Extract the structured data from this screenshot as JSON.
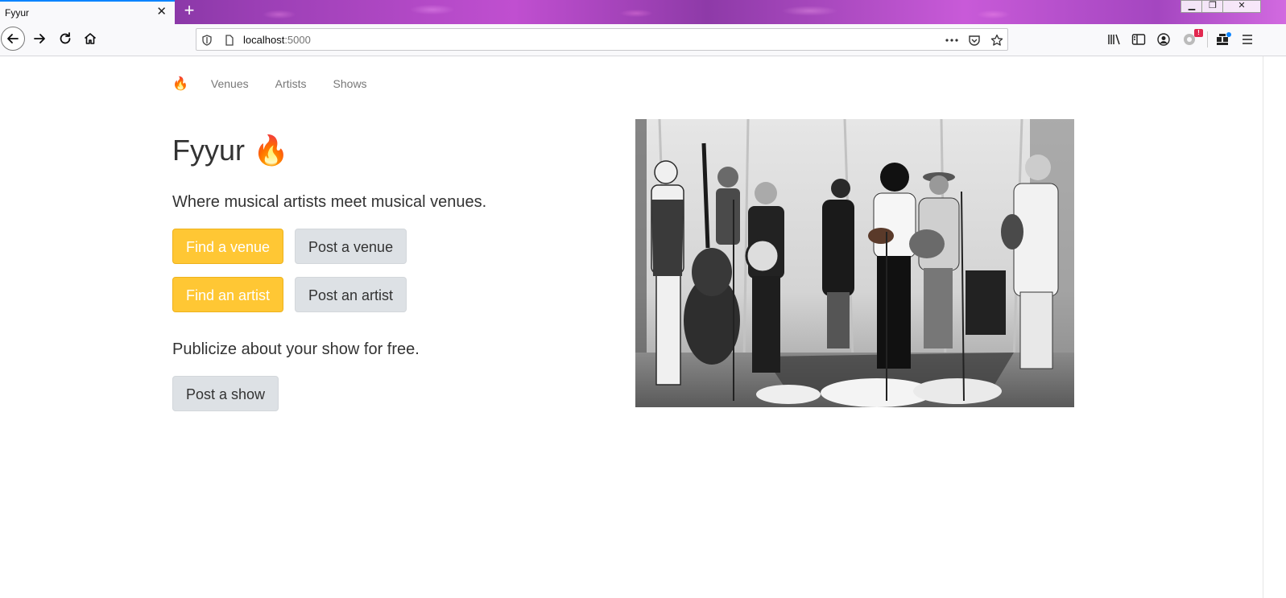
{
  "browser": {
    "tab_title": "Fyyur",
    "tab_close": "✕",
    "new_tab": "+",
    "url_host": "localhost",
    "url_port": ":5000",
    "notification_badge": "!",
    "window_controls": {
      "minimize": "▁",
      "maximize": "❐",
      "close": "✕"
    }
  },
  "site_nav": {
    "brand": "🔥",
    "links": [
      "Venues",
      "Artists",
      "Shows"
    ]
  },
  "hero": {
    "title": "Fyyur 🔥",
    "tagline": "Where musical artists meet musical venues.",
    "buttons": {
      "find_venue": "Find a venue",
      "post_venue": "Post a venue",
      "find_artist": "Find an artist",
      "post_artist": "Post an artist"
    },
    "publicize": "Publicize about your show for free.",
    "post_show": "Post a show"
  },
  "colors": {
    "primary_button": "#ffc734",
    "secondary_button": "#dde1e5",
    "tab_accent": "#0a84ff"
  },
  "icons": [
    "back-icon",
    "forward-icon",
    "reload-icon",
    "home-icon",
    "shield-icon",
    "page-icon",
    "more-icon",
    "pocket-icon",
    "star-icon",
    "library-icon",
    "sidebar-icon",
    "account-icon",
    "sync-icon",
    "extensions-icon",
    "menu-icon"
  ]
}
